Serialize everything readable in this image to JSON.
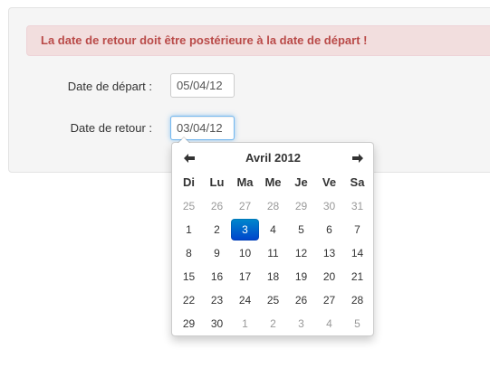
{
  "alert": {
    "message": "La date de retour doit être postérieure à la date de départ !"
  },
  "form": {
    "depart_label": "Date de départ :",
    "depart_value": "05/04/12",
    "retour_label": "Date de retour :",
    "retour_value": "03/04/12"
  },
  "datepicker": {
    "title": "Avril 2012",
    "prev_icon": "arrow-left-icon",
    "next_icon": "arrow-right-icon",
    "weekdays": [
      "Di",
      "Lu",
      "Ma",
      "Me",
      "Je",
      "Ve",
      "Sa"
    ],
    "weeks": [
      [
        {
          "d": "25",
          "other": true
        },
        {
          "d": "26",
          "other": true
        },
        {
          "d": "27",
          "other": true
        },
        {
          "d": "28",
          "other": true
        },
        {
          "d": "29",
          "other": true
        },
        {
          "d": "30",
          "other": true
        },
        {
          "d": "31",
          "other": true
        }
      ],
      [
        {
          "d": "1"
        },
        {
          "d": "2"
        },
        {
          "d": "3",
          "active": true
        },
        {
          "d": "4"
        },
        {
          "d": "5"
        },
        {
          "d": "6"
        },
        {
          "d": "7"
        }
      ],
      [
        {
          "d": "8"
        },
        {
          "d": "9"
        },
        {
          "d": "10"
        },
        {
          "d": "11"
        },
        {
          "d": "12"
        },
        {
          "d": "13"
        },
        {
          "d": "14"
        }
      ],
      [
        {
          "d": "15"
        },
        {
          "d": "16"
        },
        {
          "d": "17"
        },
        {
          "d": "18"
        },
        {
          "d": "19"
        },
        {
          "d": "20"
        },
        {
          "d": "21"
        }
      ],
      [
        {
          "d": "22"
        },
        {
          "d": "23"
        },
        {
          "d": "24"
        },
        {
          "d": "25"
        },
        {
          "d": "26"
        },
        {
          "d": "27"
        },
        {
          "d": "28"
        }
      ],
      [
        {
          "d": "29"
        },
        {
          "d": "30"
        },
        {
          "d": "1",
          "other": true
        },
        {
          "d": "2",
          "other": true
        },
        {
          "d": "3",
          "other": true
        },
        {
          "d": "4",
          "other": true
        },
        {
          "d": "5",
          "other": true
        }
      ]
    ],
    "active_color": "#0074cc",
    "muted_color": "#999999"
  },
  "colors": {
    "alert_text": "#b94a48",
    "alert_bg": "#f2dede",
    "well_bg": "#f5f5f5"
  }
}
